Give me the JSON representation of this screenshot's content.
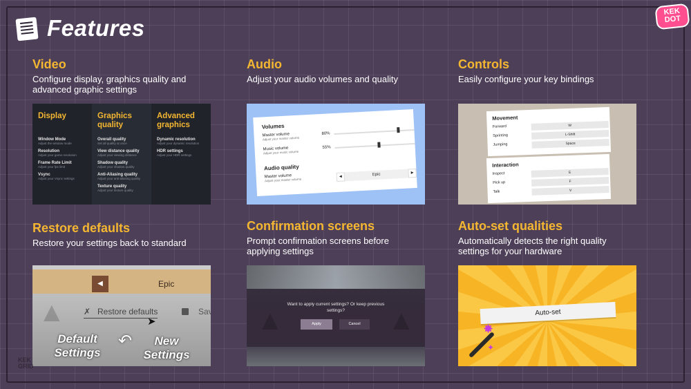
{
  "page": {
    "title": "Features",
    "logo_top": "KEK",
    "logo_bottom": "DOT"
  },
  "features": [
    {
      "id": "video",
      "heading": "Video",
      "description": "Configure display, graphics quality and advanced graphic settings"
    },
    {
      "id": "audio",
      "heading": "Audio",
      "description": "Adjust your audio volumes and quality"
    },
    {
      "id": "controls",
      "heading": "Controls",
      "description": "Easily configure your key bindings"
    },
    {
      "id": "restore",
      "heading": "Restore defaults",
      "description": "Restore your settings back to standard"
    },
    {
      "id": "confirm",
      "heading": "Confirmation screens",
      "description": "Prompt confirmation screens before applying settings"
    },
    {
      "id": "autoset",
      "heading": "Auto-set qualities",
      "description": "Automatically detects the right quality settings for your hardware"
    }
  ],
  "video_card": {
    "columns": [
      {
        "title": "Display",
        "items": [
          {
            "name": "Window Mode",
            "desc": "Adjust the window mode"
          },
          {
            "name": "Resolution",
            "desc": "Adjust your game resolution"
          },
          {
            "name": "Frame Rate Limit",
            "desc": "Adjust your fps limit"
          },
          {
            "name": "Vsync",
            "desc": "Adjust your Vsync settings"
          }
        ]
      },
      {
        "title": "Graphics quality",
        "items": [
          {
            "name": "Overall quality",
            "desc": "Set all quality at once"
          },
          {
            "name": "View distance quality",
            "desc": "Adjust your viewing distance"
          },
          {
            "name": "Shadow quality",
            "desc": "Adjust your shadow quality"
          },
          {
            "name": "Anti-Aliasing quality",
            "desc": "Adjust your anti-aliasing quality"
          },
          {
            "name": "Texture quality",
            "desc": "Adjust your texture quality"
          }
        ]
      },
      {
        "title": "Advanced graphics",
        "items": [
          {
            "name": "Dynamic resolution",
            "desc": "Adjust your dynamic resolution"
          },
          {
            "name": "HDR settings",
            "desc": "Adjust your HDR settings"
          }
        ]
      }
    ]
  },
  "audio_card": {
    "volumes_title": "Volumes",
    "master_label": "Master volume",
    "master_desc": "Adjust your master volume",
    "master_value": "80%",
    "master_fraction": 0.8,
    "music_label": "Music volume",
    "music_desc": "Adjust your music volume",
    "music_value": "55%",
    "music_fraction": 0.55,
    "quality_title": "Audio quality",
    "quality_label": "Master volume",
    "quality_desc": "Adjust your master volume",
    "quality_value": "Epic"
  },
  "controls_card": {
    "movement_title": "Movement",
    "movement": [
      {
        "action": "Forward",
        "key": "W"
      },
      {
        "action": "Sprinting",
        "key": "L-Shift"
      },
      {
        "action": "Jumping",
        "key": "Space"
      }
    ],
    "interaction_title": "Interaction",
    "interaction": [
      {
        "action": "Inspect",
        "key": "E"
      },
      {
        "action": "Pick up",
        "key": "F"
      },
      {
        "action": "Talk",
        "key": "V"
      }
    ]
  },
  "restore_card": {
    "quality_value": "Epic",
    "restore_link": "Restore defaults",
    "save_label": "Sav",
    "default_label": "Default Settings",
    "new_label": "New Settings",
    "watermark_top": "KEK",
    "watermark_bottom": "GRID"
  },
  "confirm_card": {
    "message": "Want to apply current settings? Or keep previous settings?",
    "apply_label": "Apply",
    "cancel_label": "Cancel"
  },
  "autoset_card": {
    "button_label": "Auto-set"
  }
}
